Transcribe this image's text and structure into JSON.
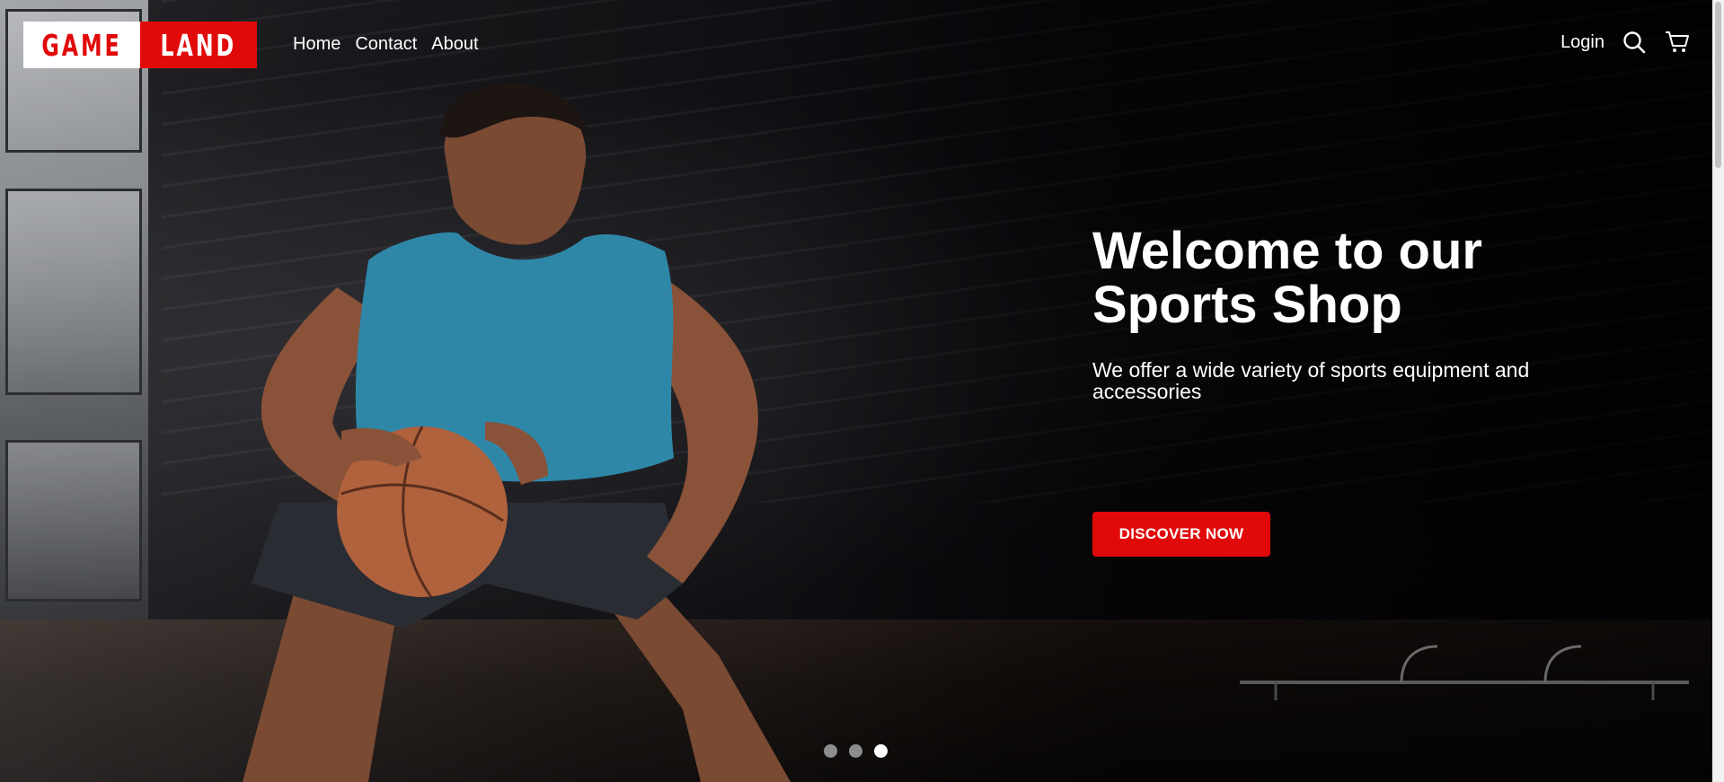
{
  "header": {
    "logo": {
      "left": "GAME",
      "right": "LAND"
    },
    "nav": [
      {
        "label": "Home"
      },
      {
        "label": "Contact"
      },
      {
        "label": "About"
      }
    ],
    "login_label": "Login",
    "icons": {
      "search": "search-icon",
      "cart": "cart-icon"
    }
  },
  "hero": {
    "title_line1": "Welcome to our",
    "title_line2": "Sports Shop",
    "subtitle": "We offer a wide variety of sports equipment and accessories",
    "cta_label": "DISCOVER NOW",
    "background": "basketball-player-gym-photo"
  },
  "carousel": {
    "slide_count": 3,
    "active_slide": 3
  },
  "colors": {
    "brand_red": "#e10a0a",
    "text": "#ffffff",
    "dot_inactive": "#8d8d8d",
    "dot_active": "#ffffff"
  }
}
